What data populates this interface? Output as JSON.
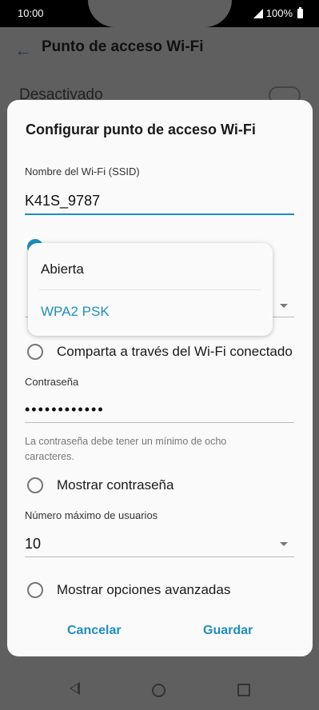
{
  "status_bar": {
    "time": "10:00",
    "battery": "100%"
  },
  "app": {
    "title": "Punto de acceso Wi-Fi",
    "toggle_label": "Desactivado"
  },
  "dialog": {
    "title": "Configurar punto de acceso Wi-Fi",
    "ssid_label": "Nombre del Wi-Fi (SSID)",
    "ssid_value": "K41S_9787",
    "share_option": "Comparta a través del Wi-Fi conectado",
    "password_label": "Contraseña",
    "password_value": "••••••••••••",
    "password_hint": "La contraseña debe tener un mínimo de ocho caracteres.",
    "show_password": "Mostrar contraseña",
    "max_users_label": "Número máximo de usuarios",
    "max_users_value": "10",
    "advanced_options": "Mostrar opciones avanzadas",
    "cancel_label": "Cancelar",
    "save_label": "Guardar"
  },
  "security_dropdown": {
    "options": [
      "Abierta",
      "WPA2 PSK"
    ],
    "selected": "WPA2 PSK"
  },
  "colors": {
    "accent": "#1e8ebf",
    "scrim": "#5f5f5f"
  }
}
